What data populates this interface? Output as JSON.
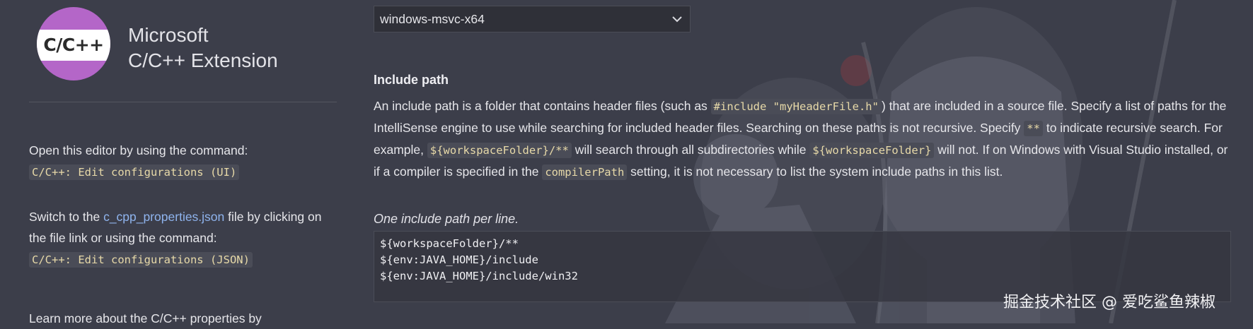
{
  "logo": {
    "text": "C/C++"
  },
  "product": {
    "line1": "Microsoft",
    "line2": "C/C++ Extension"
  },
  "sidebar": {
    "open_editor_text": "Open this editor by using the command:",
    "open_editor_command": "C/C++: Edit configurations (UI)",
    "switch_prefix": "Switch to the ",
    "switch_link": "c_cpp_properties.json",
    "switch_middle": " file by clicking on the file link or using the command:",
    "switch_command": "C/C++: Edit configurations (JSON)",
    "learn_more_text": "Learn more about the C/C++ properties by"
  },
  "configuration": {
    "selected": "windows-msvc-x64"
  },
  "include_path": {
    "title": "Include path",
    "desc": {
      "p1": "An include path is a folder that contains header files (such as ",
      "c1": "#include \"myHeaderFile.h\"",
      "p2": ") that are included in a source file. Specify a list of paths for the IntelliSense engine to use while searching for included header files. Searching on these paths is not recursive. Specify ",
      "c2": "**",
      "p3": " to indicate recursive search. For example, ",
      "c3": "${workspaceFolder}/**",
      "p4": " will search through all subdirectories while ",
      "c4": "${workspaceFolder}",
      "p5": " will not. If on Windows with Visual Studio installed, or if a compiler is specified in the ",
      "c5": "compilerPath",
      "p6": " setting, it is not necessary to list the system include paths in this list."
    },
    "hint": "One include path per line.",
    "values": [
      "${workspaceFolder}/**",
      "${env:JAVA_HOME}/include",
      "${env:JAVA_HOME}/include/win32"
    ]
  },
  "watermark": "掘金技术社区 @ 爱吃鲨鱼辣椒",
  "colors": {
    "background": "#3c3e4a",
    "logo_purple": "#b466c8",
    "link": "#8fb4ee",
    "code_bg": "#4a4c57",
    "code_text": "#e7d9a8"
  },
  "icons": {
    "dropdown": "chevron-down-icon",
    "background_art": "anime-illustration"
  }
}
